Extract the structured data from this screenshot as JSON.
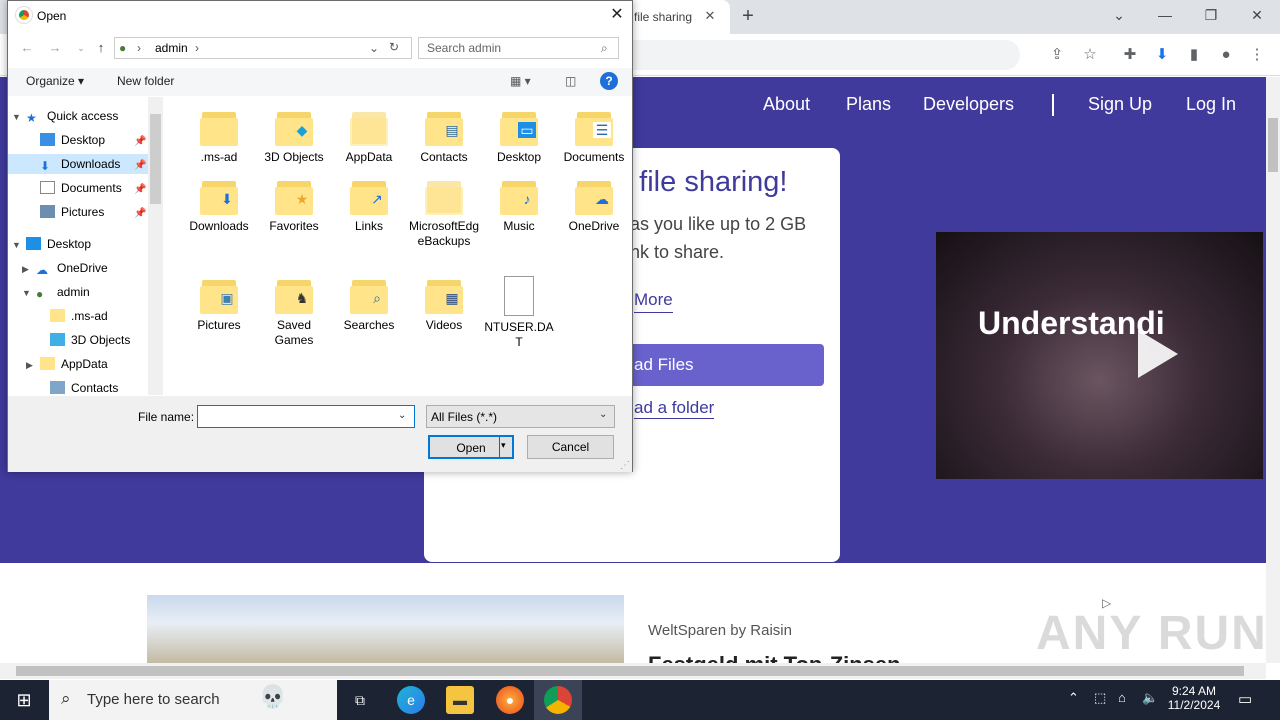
{
  "browser": {
    "tab_title": "file sharing",
    "tab_close": "✕",
    "new_tab": "+",
    "controls": {
      "dropdown": "⌄",
      "minimize": "—",
      "restore": "❐",
      "close": "✕"
    }
  },
  "page": {
    "nav": {
      "about": "About",
      "plans": "Plans",
      "developers": "Developers",
      "sign_up": "Sign Up",
      "log_in": "Log In"
    },
    "hero_title": "e file sharing!",
    "hero_sub": "as you like up to 2 GB nk to share.",
    "learn_more": "More",
    "upload_button": "ad Files",
    "upload_folder": "ad a folder",
    "video_title": "Understandi",
    "ad_source": "WeltSparen by Raisin",
    "ad_headline": "Festgeld mit Top-Zinsen",
    "watermark": "ANY RUN"
  },
  "dialog": {
    "title": "Open",
    "close": "✕",
    "address": {
      "root": "admin",
      "sep": "›"
    },
    "search_placeholder": "Search admin",
    "organize": "Organize ▾",
    "new_folder": "New folder",
    "tree": [
      {
        "label": "Quick access",
        "icon": "star-icon"
      },
      {
        "label": "Desktop",
        "icon": "desktop-icon"
      },
      {
        "label": "Downloads",
        "icon": "download-icon"
      },
      {
        "label": "Documents",
        "icon": "document-icon"
      },
      {
        "label": "Pictures",
        "icon": "pictures-icon"
      },
      {
        "label": "Desktop",
        "icon": "desktop-icon"
      },
      {
        "label": "OneDrive",
        "icon": "cloud-icon"
      },
      {
        "label": "admin",
        "icon": "user-icon"
      },
      {
        "label": ".ms-ad",
        "icon": "folder-icon"
      },
      {
        "label": "3D Objects",
        "icon": "cube-icon"
      },
      {
        "label": "AppData",
        "icon": "folder-icon"
      },
      {
        "label": "Contacts",
        "icon": "contacts-icon"
      }
    ],
    "files": [
      {
        "label": ".ms-ad",
        "glyph": ""
      },
      {
        "label": "3D Objects",
        "glyph": "◆"
      },
      {
        "label": "AppData",
        "glyph": ""
      },
      {
        "label": "Contacts",
        "glyph": "▤"
      },
      {
        "label": "Desktop",
        "glyph": "▭"
      },
      {
        "label": "Documents",
        "glyph": "☰"
      },
      {
        "label": "Downloads",
        "glyph": "⬇"
      },
      {
        "label": "Favorites",
        "glyph": "★"
      },
      {
        "label": "Links",
        "glyph": "↗"
      },
      {
        "label": "MicrosoftEdgeBackups",
        "glyph": ""
      },
      {
        "label": "Music",
        "glyph": "♪"
      },
      {
        "label": "OneDrive",
        "glyph": "☁"
      },
      {
        "label": "Pictures",
        "glyph": "▣"
      },
      {
        "label": "Saved Games",
        "glyph": "♞"
      },
      {
        "label": "Searches",
        "glyph": "⌕"
      },
      {
        "label": "Videos",
        "glyph": "▦"
      },
      {
        "label": "NTUSER.DAT",
        "glyph": ""
      }
    ],
    "file_name_label": "File name:",
    "file_name_value": "",
    "file_type": "All Files (*.*)",
    "open_button": "Open",
    "cancel_button": "Cancel"
  },
  "taskbar": {
    "search_placeholder": "Type here to search",
    "time": "9:24 AM",
    "date": "11/2/2024"
  }
}
